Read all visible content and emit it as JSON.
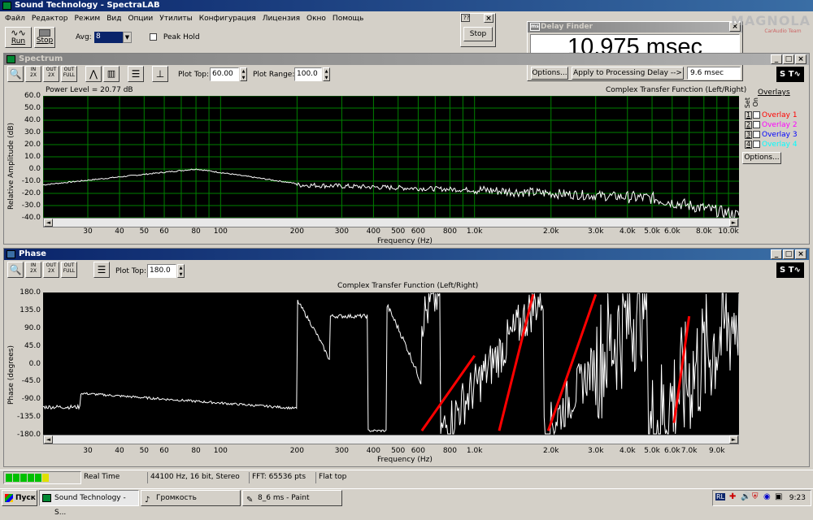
{
  "app": {
    "title": "Sound Technology - SpectraLAB",
    "menu": [
      "Файл",
      "Редактор",
      "Режим",
      "Вид",
      "Опции",
      "Утилиты",
      "Конфигурация",
      "Лицензия",
      "Окно",
      "Помощь"
    ]
  },
  "toolbar": {
    "run_label": "Run",
    "stop_label": "Stop",
    "avg_label": "Avg:",
    "avg_value": "8",
    "peak_hold_label": "Peak Hold"
  },
  "stop_popup": {
    "title": "??",
    "stop_label": "Stop"
  },
  "delay_finder": {
    "title": "Delay Finder",
    "value": "10.975 msec",
    "options_label": "Options...",
    "apply_label": "Apply to Processing Delay -->",
    "processing_delay": "9.6 msec"
  },
  "watermark": {
    "brand": "MAGNOLA",
    "sub": "CarAudio Team"
  },
  "spectrum": {
    "title": "Spectrum",
    "plot_top_label": "Plot Top:",
    "plot_top_value": "60.00",
    "plot_range_label": "Plot Range:",
    "plot_range_value": "100.0",
    "power_level": "Power Level = 20.77 dB",
    "function_title": "Complex Transfer Function (Left/Right)",
    "ylabel": "Relative Amplitude (dB)",
    "xlabel": "Frequency (Hz)",
    "yticks": [
      "60.0",
      "50.0",
      "40.0",
      "30.0",
      "20.0",
      "10.0",
      "0.0",
      "-10.0",
      "-20.0",
      "-30.0",
      "-40.0"
    ],
    "xticks": [
      "30",
      "40",
      "50",
      "60",
      "80",
      "100",
      "200",
      "300",
      "400",
      "500",
      "600",
      "800",
      "1.0k",
      "2.0k",
      "3.0k",
      "4.0k",
      "5.0k",
      "6.0k",
      "8.0k",
      "10.0k"
    ],
    "overlays_title": "Overlays",
    "overlay_col1": "Set",
    "overlay_col2": "On",
    "overlays": [
      {
        "num": "1",
        "label": "Overlay 1",
        "color": "#ff0000"
      },
      {
        "num": "2",
        "label": "Overlay 2",
        "color": "#ff00ff"
      },
      {
        "num": "3",
        "label": "Overlay 3",
        "color": "#0000ff"
      },
      {
        "num": "4",
        "label": "Overlay 4",
        "color": "#00ffff"
      }
    ],
    "overlay_options_label": "Options..."
  },
  "phase": {
    "title": "Phase",
    "plot_top_label": "Plot Top:",
    "plot_top_value": "180.0",
    "function_title": "Complex Transfer Function (Left/Right)",
    "ylabel": "Phase (degrees)",
    "xlabel": "Frequency (Hz)",
    "yticks": [
      "180.0",
      "135.0",
      "90.0",
      "45.0",
      "0.0",
      "-45.0",
      "-90.0",
      "-135.0",
      "-180.0"
    ],
    "xticks": [
      "30",
      "40",
      "50",
      "60",
      "80",
      "100",
      "200",
      "300",
      "400",
      "500",
      "600",
      "800",
      "1.0k",
      "2.0k",
      "3.0k",
      "4.0k",
      "5.0k",
      "6.0k",
      "7.0k",
      "9.0k"
    ]
  },
  "status": {
    "mode": "Real Time",
    "format": "44100 Hz, 16 bit, Stereo",
    "fft": "FFT: 65536 pts",
    "window": "Flat top"
  },
  "taskbar": {
    "start": "Пуск",
    "items": [
      "Sound Technology - S...",
      "Громкость",
      "8_6 ms - Paint"
    ],
    "clock": "9:23",
    "lang": "RL"
  },
  "colors": {
    "trace": "#ffffff",
    "grid": "#008000",
    "fit_line": "#ff0000",
    "titlebar": "#0a246a"
  }
}
